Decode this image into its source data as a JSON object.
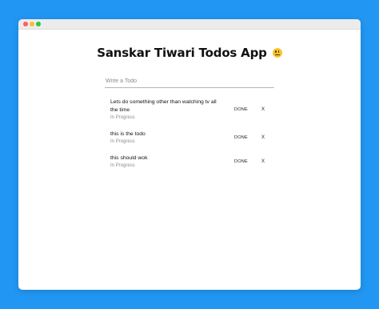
{
  "colors": {
    "background": "#2196f3",
    "window": "#ffffff",
    "titlebar": "#ececec"
  },
  "window": {
    "traffic_lights": [
      "close",
      "minimize",
      "maximize"
    ]
  },
  "app": {
    "title": "Sanskar Tiwari Todos App",
    "title_emoji_icon": "smiley-face-icon"
  },
  "input": {
    "placeholder": "Write a Todo",
    "value": ""
  },
  "todos": [
    {
      "text": "Lets do something other than watching tv all the time",
      "status": "In Progress",
      "done_label": "DONE",
      "delete_label": "X"
    },
    {
      "text": "this is the todo",
      "status": "In Progress",
      "done_label": "DONE",
      "delete_label": "X"
    },
    {
      "text": "this should wok",
      "status": "In Progress",
      "done_label": "DONE",
      "delete_label": "X"
    }
  ]
}
